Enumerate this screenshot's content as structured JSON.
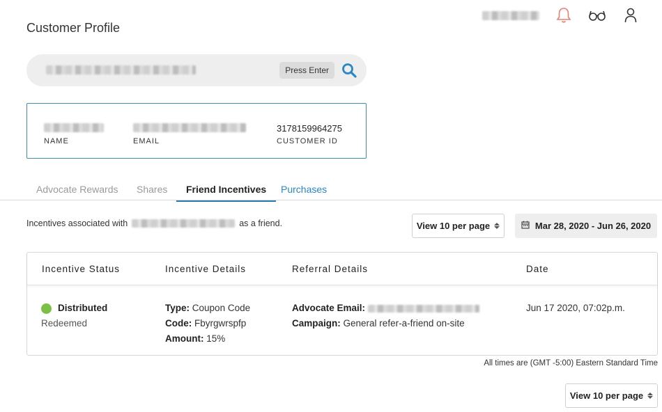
{
  "header": {
    "page_title": "Customer Profile",
    "user_name_redacted": true,
    "colors": {
      "bell": "#e8806e",
      "accent": "#2a86c6"
    }
  },
  "search": {
    "placeholder": "",
    "value_redacted": true,
    "press_enter_label": "Press Enter"
  },
  "profile": {
    "name_label": "NAME",
    "email_label": "EMAIL",
    "customer_id_value": "3178159964275",
    "customer_id_label": "CUSTOMER ID"
  },
  "tabs": [
    {
      "label": "Advocate Rewards",
      "state": "inactive"
    },
    {
      "label": "Shares",
      "state": "inactive"
    },
    {
      "label": "Friend Incentives",
      "state": "active"
    },
    {
      "label": "Purchases",
      "state": "link"
    }
  ],
  "toolbar": {
    "incentives_prefix": "Incentives associated with",
    "incentives_suffix": "as a friend.",
    "per_page_label": "View 10 per page",
    "date_range": "Mar 28, 2020 - Jun 26, 2020"
  },
  "table": {
    "headers": [
      "Incentive Status",
      "Incentive Details",
      "Referral Details",
      "Date"
    ],
    "rows": [
      {
        "status": "Distributed",
        "status_color": "#7cbf45",
        "sub_status": "Redeemed",
        "type_label": "Type:",
        "type_value": "Coupon Code",
        "code_label": "Code:",
        "code_value": "Fbyrgwrspfp",
        "amount_label": "Amount:",
        "amount_value": "15%",
        "advocate_email_label": "Advocate Email:",
        "campaign_label": "Campaign:",
        "campaign_value": "General refer-a-friend on-site",
        "date": "Jun 17 2020, 07:02p.m."
      }
    ]
  },
  "footer": {
    "timezone_note": "All times are (GMT -5:00) Eastern Standard Time",
    "per_page_label": "View 10 per page"
  }
}
